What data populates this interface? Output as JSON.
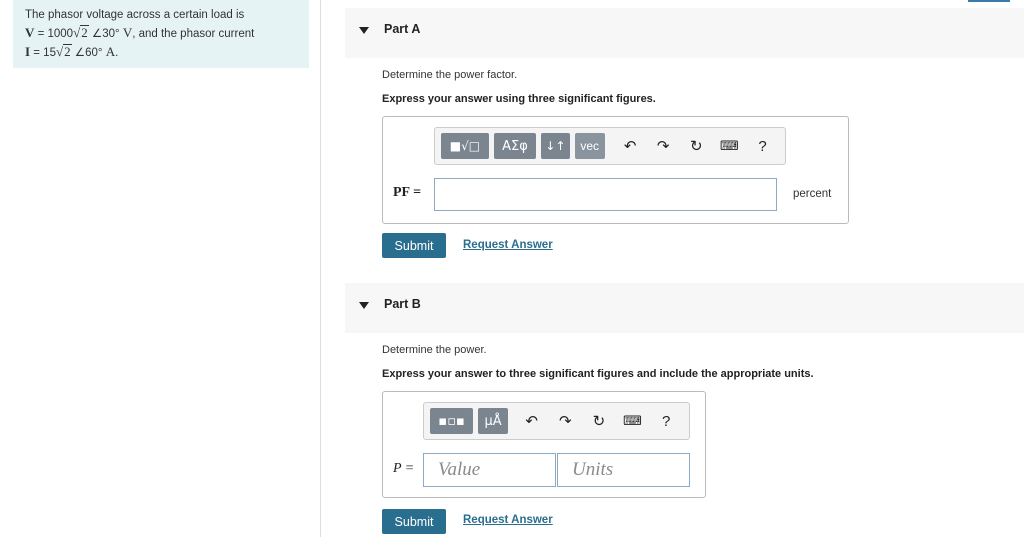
{
  "problem": {
    "line1": "The phasor voltage across a certain load is",
    "v_var": "V",
    "v_eq": " = 1000",
    "v_sqrt": "2",
    "v_angle": " ∠30° ",
    "v_unit": "V",
    "v_tail": ", and the phasor current",
    "i_var": "I",
    "i_eq": " = 15",
    "i_sqrt": "2",
    "i_angle": " ∠60° ",
    "i_unit": "A",
    "i_tail": "."
  },
  "partA": {
    "title": "Part A",
    "prompt": "Determine the power factor.",
    "instruction": "Express your answer using three significant figures.",
    "toolbar": {
      "template_btn": "■√□",
      "greek_btn": "ΑΣφ",
      "arrows_btn": "↓↑",
      "vec_btn": "vec",
      "help": "?"
    },
    "field_label": "PF =",
    "unit": "percent",
    "submit": "Submit",
    "request": "Request Answer"
  },
  "partB": {
    "title": "Part B",
    "prompt": "Determine the power.",
    "instruction": "Express your answer to three significant figures and include the appropriate units.",
    "toolbar": {
      "units_btn": "μÅ",
      "help": "?"
    },
    "field_label": "P =",
    "value_placeholder": "Value",
    "units_placeholder": "Units",
    "submit": "Submit",
    "request": "Request Answer"
  }
}
